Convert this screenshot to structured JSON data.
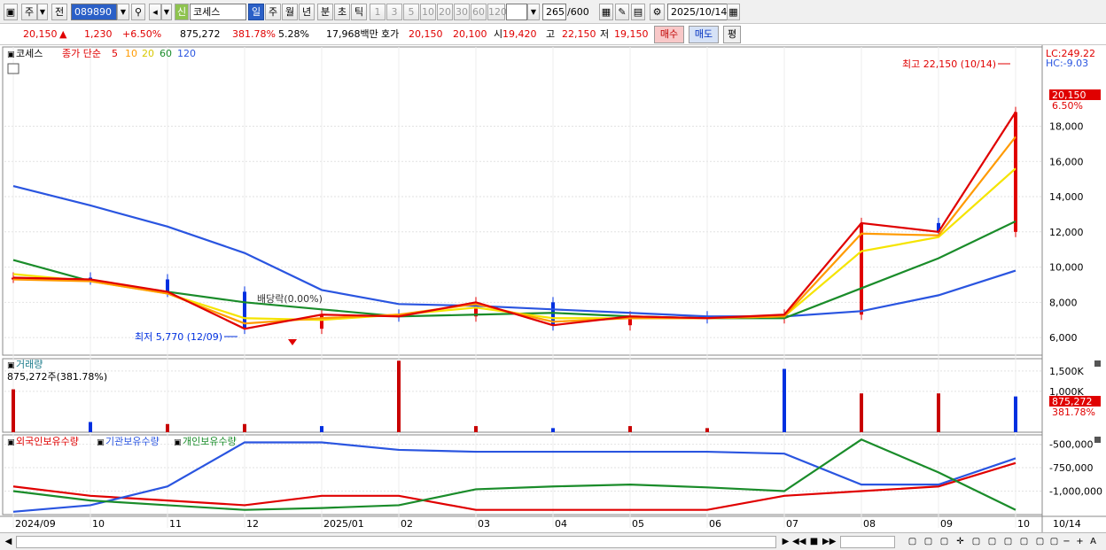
{
  "toolbar": {
    "period_kr": "주",
    "prev_kr": "전",
    "code": "089890",
    "credit_kr": "신",
    "stock_name": "코세스",
    "periods": [
      "일",
      "주",
      "월",
      "년",
      "분",
      "초",
      "틱"
    ],
    "active_period": "일",
    "intervals": [
      "1",
      "3",
      "5",
      "10",
      "20",
      "30",
      "60",
      "120"
    ],
    "count": "265",
    "count_total": "/600",
    "date": "2025/10/14"
  },
  "quote": {
    "price": "20,150",
    "arrow": "▲",
    "change": "1,230",
    "change_pct": "+6.50%",
    "volume": "875,272",
    "volume_ratio": "381.78%",
    "turnover": "5.28%",
    "amount": "17,968백만",
    "hoga_kr": "호가",
    "ask": "20,150",
    "bid": "20,100",
    "open_kr": "시",
    "open": "19,420",
    "high_kr": "고",
    "high": "22,150",
    "low_kr": "저",
    "low": "19,150",
    "buy_kr": "매수",
    "sell_kr": "매도",
    "eval_kr": "평"
  },
  "price_panel": {
    "title": "코세스",
    "legend_label": "종가 단순",
    "ma_periods": [
      "5",
      "10",
      "20",
      "60",
      "120"
    ],
    "ma_colors": [
      "#e00000",
      "#ff9a00",
      "#f5e400",
      "#1a8c2a",
      "#2a55e0"
    ],
    "lc": "LC:249.22",
    "hc": "HC:-9.03",
    "last_price": "20,150",
    "last_pct": "6.50%",
    "high_note": "최고 22,150 (10/14)",
    "low_note": "최저 5,770 (12/09)",
    "dividend_note": "배당락(0.00%)",
    "y_ticks": [
      "6,000",
      "8,000",
      "10,000",
      "12,000",
      "14,000",
      "16,000",
      "18,000"
    ]
  },
  "volume_panel": {
    "title": "거래량",
    "value_note": "875,272주(381.78%)",
    "y_ticks": [
      "1,500K",
      "1,000K"
    ],
    "last": "875,272",
    "last_pct": "381.78%"
  },
  "holdings_panel": {
    "legend": [
      "외국인보유수량",
      "기관보유수량",
      "개인보유수량"
    ],
    "colors": [
      "#e00000",
      "#2a55e0",
      "#1a8c2a"
    ],
    "y_ticks": [
      "-500,000",
      "-750,000",
      "-1,000,000"
    ]
  },
  "x_axis": {
    "labels": [
      "2024/09",
      "10",
      "11",
      "12",
      "2025/01",
      "02",
      "03",
      "04",
      "05",
      "06",
      "07",
      "08",
      "09",
      "10"
    ],
    "last_date": "10/14"
  },
  "chart_data": [
    {
      "type": "line",
      "title": "코세스",
      "x": [
        "2024/09",
        "2024/10",
        "2024/11",
        "2024/12",
        "2025/01",
        "2025/02",
        "2025/03",
        "2025/04",
        "2025/05",
        "2025/06",
        "2025/07",
        "2025/08",
        "2025/09",
        "2025/10/14"
      ],
      "ylim": [
        5000,
        22500
      ],
      "series": [
        {
          "name": "5",
          "values": [
            9400,
            9300,
            8600,
            6500,
            7300,
            7200,
            8000,
            6700,
            7200,
            7100,
            7300,
            12500,
            12000,
            18800
          ]
        },
        {
          "name": "10",
          "values": [
            9300,
            9200,
            8500,
            6800,
            7100,
            7300,
            7900,
            6900,
            7100,
            7100,
            7200,
            11900,
            11800,
            17400
          ]
        },
        {
          "name": "20",
          "values": [
            9600,
            9200,
            8500,
            7100,
            7000,
            7300,
            7700,
            7100,
            7100,
            7100,
            7200,
            10900,
            11700,
            15600
          ]
        },
        {
          "name": "60",
          "values": [
            10400,
            9200,
            8600,
            8000,
            7600,
            7200,
            7300,
            7400,
            7200,
            7100,
            7100,
            8800,
            10500,
            12600
          ]
        },
        {
          "name": "120",
          "values": [
            14600,
            13500,
            12300,
            10800,
            8700,
            7900,
            7800,
            7600,
            7400,
            7200,
            7200,
            7500,
            8400,
            9800
          ]
        }
      ],
      "annotations": [
        "최고 22,150 (10/14)",
        "최저 5,770 (12/09)",
        "배당락(0.00%)"
      ]
    },
    {
      "type": "bar",
      "title": "거래량",
      "categories": [
        "2024/09",
        "2024/10",
        "2024/11",
        "2024/12",
        "2025/01",
        "2025/02",
        "2025/03",
        "2025/04",
        "2025/05",
        "2025/06",
        "2025/07",
        "2025/08",
        "2025/09",
        "2025/10/14"
      ],
      "values": [
        1050,
        250,
        200,
        200,
        150,
        1750,
        150,
        100,
        150,
        100,
        1550,
        950,
        950,
        875.272
      ],
      "ylabel": "K"
    },
    {
      "type": "line",
      "title": "보유수량",
      "x": [
        "2024/09",
        "2024/10",
        "2024/11",
        "2024/12",
        "2025/01",
        "2025/02",
        "2025/03",
        "2025/04",
        "2025/05",
        "2025/06",
        "2025/07",
        "2025/08",
        "2025/09",
        "2025/10/14"
      ],
      "ylim": [
        -1250000,
        -400000
      ],
      "series": [
        {
          "name": "외국인보유수량",
          "values": [
            -950000,
            -1050000,
            -1100000,
            -1150000,
            -1050000,
            -1050000,
            -1200000,
            -1200000,
            -1200000,
            -1200000,
            -1050000,
            -1000000,
            -950000,
            -700000
          ]
        },
        {
          "name": "기관보유수량",
          "values": [
            -1220000,
            -1150000,
            -950000,
            -480000,
            -480000,
            -560000,
            -580000,
            -580000,
            -580000,
            -580000,
            -600000,
            -930000,
            -930000,
            -650000
          ]
        },
        {
          "name": "개인보유수량",
          "values": [
            -1000000,
            -1100000,
            -1150000,
            -1200000,
            -1180000,
            -1150000,
            -980000,
            -950000,
            -930000,
            -960000,
            -1000000,
            -450000,
            -800000,
            -1200000
          ]
        }
      ]
    }
  ]
}
